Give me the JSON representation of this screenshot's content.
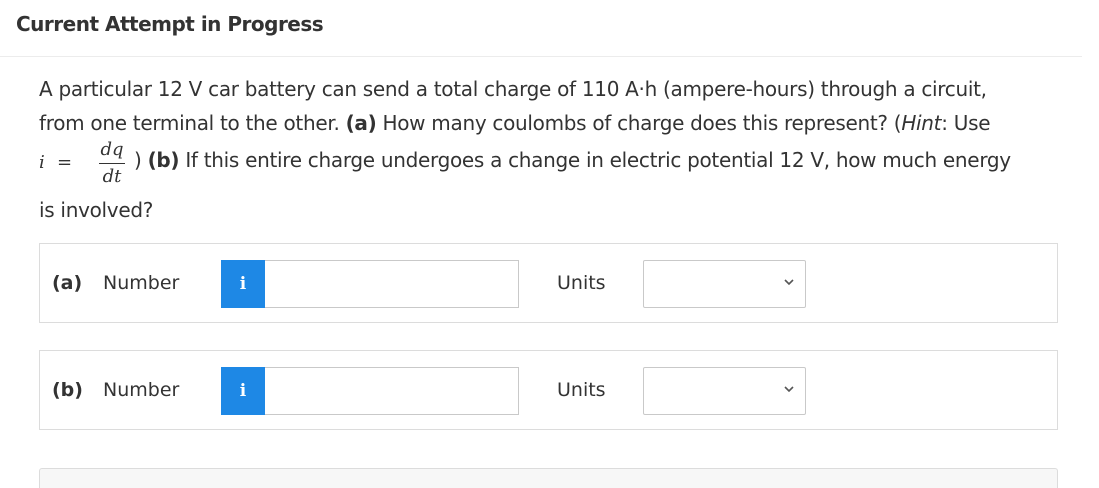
{
  "header": {
    "title": "Current Attempt in Progress"
  },
  "question": {
    "line1": "A particular 12 V car battery can send a total charge of 110 A·h (ampere-hours) through a circuit,",
    "line2_pre": "from one terminal to the other. ",
    "part_a_tag": "(a)",
    "line2_post": " How many coulombs of charge does this represent? (",
    "hint_word": "Hint",
    "line2_end": ": Use",
    "math_i": "i",
    "math_eq": "=",
    "frac_num": "dq",
    "frac_den": "dt",
    "line3_pre": ") ",
    "part_b_tag": "(b)",
    "line3_post": " If this entire charge undergoes a change in electric potential 12 V, how much energy",
    "line4": "is involved?"
  },
  "answers": [
    {
      "part": "(a)",
      "number_label": "Number",
      "info": "i",
      "value": "",
      "units_label": "Units",
      "units_value": ""
    },
    {
      "part": "(b)",
      "number_label": "Number",
      "info": "i",
      "value": "",
      "units_label": "Units",
      "units_value": ""
    }
  ]
}
